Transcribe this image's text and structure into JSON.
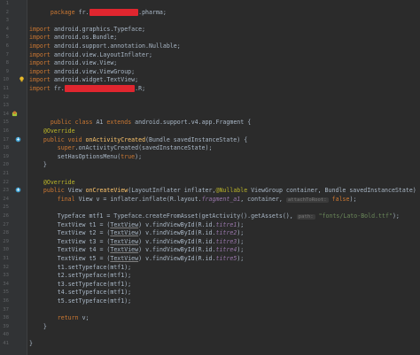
{
  "code": {
    "l1_package": "package",
    "l1_name_a": "fr.",
    "l1_name_b": ".pharma;",
    "imports": [
      "android.graphics.Typeface;",
      "android.os.Bundle;",
      "android.support.annotation.Nullable;",
      "android.view.LayoutInflater;",
      "android.view.View;",
      "android.view.ViewGroup;",
      "android.widget.TextView;"
    ],
    "import_kw": "import",
    "import_last_a": "fr.",
    "import_last_b": ".R;",
    "class_decl_kw": "public class",
    "class_name": "A1",
    "extends_kw": "extends",
    "extends_name": "android.support.v4.app.Fragment {",
    "override": "@Override",
    "oncreate_sig_kw": "public void",
    "oncreate_name": "onActivityCreated",
    "oncreate_params": "(Bundle savedInstanceState) {",
    "super_kw": "super",
    "super_rest": ".onActivityCreated(savedInstanceState);",
    "set_has_options": "setHasOptionsMenu(",
    "true_kw": "true",
    "close_paren_semi": ");",
    "close_brace": "}",
    "oncreateview_kw": "public",
    "oncreateview_type": "View",
    "oncreateview_name": "onCreateView",
    "oncreateview_params_a": "(LayoutInflater inflater,",
    "nullable_ann": "@Nullable",
    "oncreateview_params_b": "ViewGroup container, Bundle savedInstanceState) {",
    "final_kw": "final",
    "view_decl": "View v = inflater.inflate(R.layout.",
    "layout_field": "fragment_a1",
    "view_decl_b": ", container,",
    "attach_hint": "attachToRoot:",
    "false_kw": "false",
    "typeface_a": "Typeface mtf1 = Typeface.createFromAsset(getActivity().getAssets(),",
    "path_hint": "path:",
    "typeface_str": "\"fonts/Lato-Bold.ttf\"",
    "tv_lines": [
      {
        "var": "t1",
        "id": "titre1"
      },
      {
        "var": "t2",
        "id": "titre2"
      },
      {
        "var": "t3",
        "id": "titre3"
      },
      {
        "var": "t4",
        "id": "titre4"
      },
      {
        "var": "t5",
        "id": "titre5"
      }
    ],
    "tv_type": "TextView",
    "tv_cast": "TextView",
    "tv_find": "v.findViewById(R.id.",
    "settf_lines": [
      "t1",
      "t2",
      "t3",
      "t4",
      "t5"
    ],
    "settf_call": ".setTypeface(mtf1);",
    "return_kw": "return",
    "return_val": "v;"
  },
  "line_numbers": [
    "1",
    "2",
    "3",
    "4",
    "5",
    "6",
    "7",
    "8",
    "9",
    "10",
    "11",
    "12",
    "13",
    "14",
    "15",
    "16",
    "17",
    "18",
    "19",
    "20",
    "21",
    "22",
    "23",
    "24",
    "25",
    "26",
    "27",
    "28",
    "29",
    "30",
    "31",
    "32",
    "33",
    "34",
    "35",
    "36",
    "37",
    "38",
    "39",
    "40",
    "41"
  ]
}
